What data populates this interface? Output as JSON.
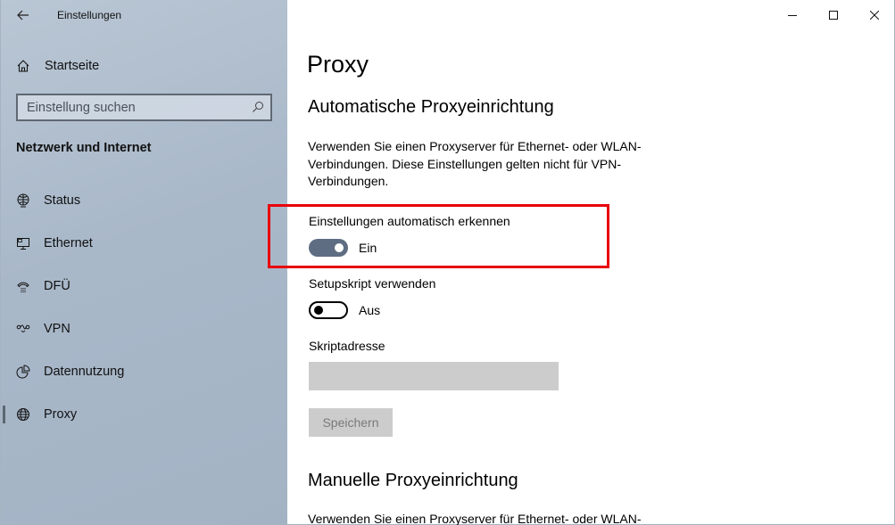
{
  "window": {
    "title": "Einstellungen",
    "caption": {
      "minimize": "minimize",
      "maximize": "maximize",
      "close": "close"
    }
  },
  "sidebar": {
    "home_label": "Startseite",
    "search_placeholder": "Einstellung suchen",
    "search_value": "",
    "section_title": "Netzwerk und Internet",
    "items": [
      {
        "label": "Status",
        "icon": "globe-monitor-icon",
        "selected": false
      },
      {
        "label": "Ethernet",
        "icon": "ethernet-monitor-icon",
        "selected": false
      },
      {
        "label": "DFÜ",
        "icon": "dialup-phone-icon",
        "selected": false
      },
      {
        "label": "VPN",
        "icon": "vpn-icon",
        "selected": false
      },
      {
        "label": "Datennutzung",
        "icon": "pie-chart-icon",
        "selected": false
      },
      {
        "label": "Proxy",
        "icon": "globe-icon",
        "selected": true
      }
    ]
  },
  "main": {
    "page_title": "Proxy",
    "auto_section": {
      "title": "Automatische Proxyeinrichtung",
      "description": "Verwenden Sie einen Proxyserver für Ethernet- oder WLAN-Verbindungen. Diese Einstellungen gelten nicht für VPN-Verbindungen.",
      "auto_detect": {
        "label": "Einstellungen automatisch erkennen",
        "state": "Ein",
        "on": true
      },
      "setup_script": {
        "label": "Setupskript verwenden",
        "state": "Aus",
        "on": false
      },
      "script_address": {
        "label": "Skriptadresse",
        "value": ""
      },
      "save_label": "Speichern"
    },
    "manual_section": {
      "title": "Manuelle Proxyeinrichtung",
      "description": "Verwenden Sie einen Proxyserver für Ethernet- oder WLAN-"
    }
  },
  "colors": {
    "highlight": "#e8000b",
    "toggle_on": "#5e6d82"
  }
}
